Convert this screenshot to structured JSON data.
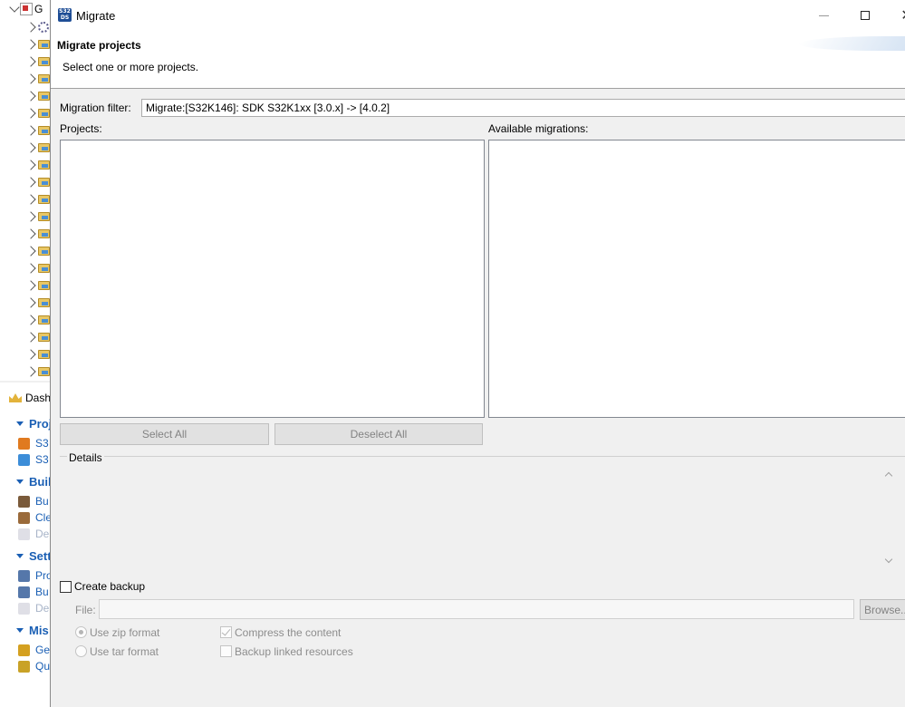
{
  "ide": {
    "tree_root_label": "G",
    "dashboard_tab": "Dash",
    "sections": [
      {
        "label": "Proj",
        "items": [
          {
            "label": "S3",
            "disabled": false
          },
          {
            "label": "S3",
            "disabled": false
          }
        ]
      },
      {
        "label": "Buil",
        "items": [
          {
            "label": "Bu",
            "disabled": false
          },
          {
            "label": "Cle",
            "disabled": false
          },
          {
            "label": "De",
            "disabled": true
          }
        ]
      },
      {
        "label": "Sett",
        "items": [
          {
            "label": "Pro",
            "disabled": false
          },
          {
            "label": "Bu",
            "disabled": false
          },
          {
            "label": "De",
            "disabled": true
          }
        ]
      },
      {
        "label": "Mis",
        "items": [
          {
            "label": "Ge",
            "disabled": false
          },
          {
            "label": "Qu",
            "disabled": false
          }
        ]
      }
    ]
  },
  "dialog": {
    "icon_text_top": "S32",
    "icon_text_bottom": "DS",
    "title": "Migrate",
    "header_title": "Migrate projects",
    "header_description": "Select one or more projects.",
    "filter_label": "Migration filter:",
    "filter_value": "Migrate:[S32K146]: SDK S32K1xx [3.0.x] -> [4.0.2]",
    "projects_label": "Projects:",
    "migrations_label": "Available migrations:",
    "select_all": "Select All",
    "deselect_all": "Deselect All",
    "details_label": "Details",
    "create_backup_label": "Create backup",
    "create_backup_checked": false,
    "file_label": "File:",
    "file_value": "",
    "browse_label": "Browse...",
    "use_zip_label": "Use zip format",
    "use_zip_selected": true,
    "use_tar_label": "Use tar format",
    "use_tar_selected": false,
    "compress_label": "Compress the content",
    "compress_checked": true,
    "linked_label": "Backup linked resources",
    "linked_checked": false
  }
}
